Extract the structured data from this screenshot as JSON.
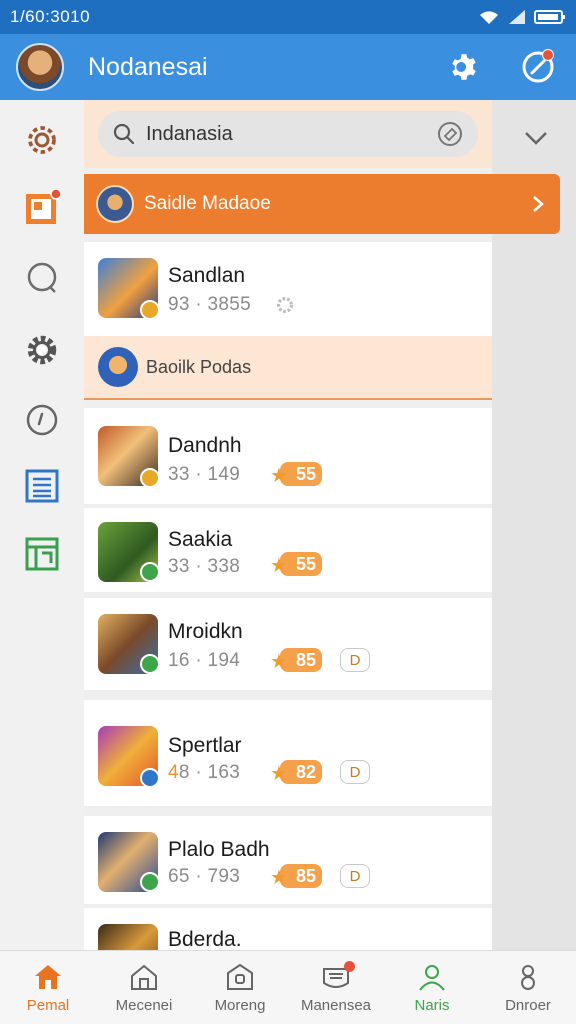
{
  "status": {
    "time": "1/60:3010"
  },
  "appbar": {
    "title": "Nodanesai"
  },
  "search": {
    "value": "Indanasia"
  },
  "banner": {
    "label": "Saidle Madaoe"
  },
  "section": {
    "label": "Baoilk Podas"
  },
  "apps": [
    {
      "name": "Sandlan",
      "meta_a": "9",
      "meta_b": "3 · 3855",
      "rating": "",
      "tag": ""
    },
    {
      "name": "Dandnh",
      "meta_a": "33",
      "meta_b": " · 149",
      "rating": "55",
      "tag": ""
    },
    {
      "name": "Saakia",
      "meta_a": "33",
      "meta_b": " · 338",
      "rating": "55",
      "tag": ""
    },
    {
      "name": "Mroidkn",
      "meta_a": "16",
      "meta_b": " · 194",
      "rating": "85",
      "tag": "D"
    },
    {
      "name": "Spertlar",
      "meta_a": "4",
      "meta_b": "8 · 163",
      "rating": "82",
      "tag": "D"
    },
    {
      "name": "Plalo Badh",
      "meta_a": "65",
      "meta_b": " · 793",
      "rating": "85",
      "tag": "D"
    },
    {
      "name": "Bderda.",
      "meta_a": "",
      "meta_b": "",
      "rating": "",
      "tag": ""
    }
  ],
  "tabs": [
    {
      "label": "Pemal"
    },
    {
      "label": "Mecenei"
    },
    {
      "label": "Moreng"
    },
    {
      "label": "Manensea"
    },
    {
      "label": "Naris"
    },
    {
      "label": "Dnroer"
    }
  ],
  "colors": {
    "appbar": "#3a8fde",
    "statusbar": "#1f6fc1",
    "accent": "#ec7c2e",
    "rating": "#f4a14a",
    "active_tab": "#e8741f",
    "green_tab": "#3ea54a"
  },
  "icons": {
    "sidebar": [
      "gear-outline-icon",
      "notice-board-icon",
      "chat-bubble-icon",
      "gear-icon",
      "compass-icon",
      "list-icon",
      "sheet-icon"
    ],
    "appbar": [
      "settings-icon",
      "edit-icon"
    ]
  }
}
